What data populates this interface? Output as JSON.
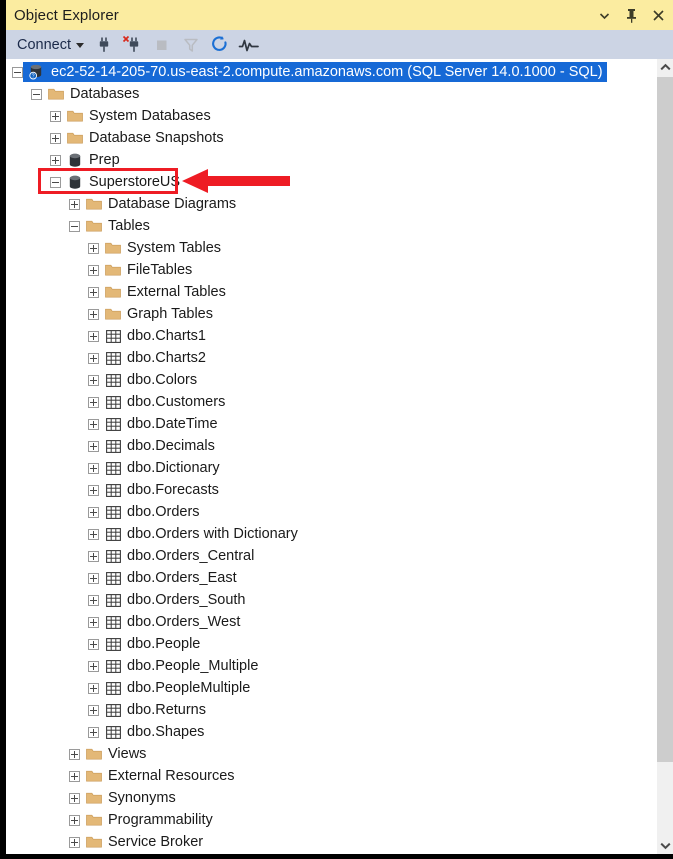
{
  "window": {
    "title": "Object Explorer",
    "controls": [
      {
        "name": "dropdown-icon",
        "label": "▾"
      },
      {
        "name": "pin-icon",
        "label": "Pin"
      },
      {
        "name": "close-icon",
        "label": "×"
      }
    ]
  },
  "toolbar": {
    "connect_label": "Connect",
    "icons": [
      {
        "name": "connect-icon",
        "title": "Connect",
        "enabled": true
      },
      {
        "name": "disconnect-icon",
        "title": "Disconnect",
        "enabled": true
      },
      {
        "name": "stop-icon",
        "title": "Stop",
        "enabled": false
      },
      {
        "name": "filter-icon",
        "title": "Filter",
        "enabled": false
      },
      {
        "name": "refresh-icon",
        "title": "Refresh",
        "enabled": true
      },
      {
        "name": "activity-monitor-icon",
        "title": "Activity Monitor",
        "enabled": true
      }
    ]
  },
  "colors": {
    "titlebar_bg": "#fbeca0",
    "toolbar_bg": "#ccd4e4",
    "selection_blue": "#1669d6",
    "folder_gold": "#e3b877",
    "annotation_red": "#ee1c24",
    "tree_bg": "#ffffff",
    "scrollbar_thumb": "#cdcdcd"
  },
  "tree": {
    "nodes": [
      {
        "label": "ec2-52-14-205-70.us-east-2.compute.amazonaws.com (SQL Server 14.0.1000 - SQL)",
        "indent": 0,
        "state": "expanded",
        "icon": "server-icon",
        "selected": true
      },
      {
        "label": "Databases",
        "indent": 1,
        "state": "expanded",
        "icon": "folder-icon",
        "selected": false
      },
      {
        "label": "System Databases",
        "indent": 2,
        "state": "collapsed",
        "icon": "folder-icon",
        "selected": false
      },
      {
        "label": "Database Snapshots",
        "indent": 2,
        "state": "collapsed",
        "icon": "folder-icon",
        "selected": false
      },
      {
        "label": "Prep",
        "indent": 2,
        "state": "collapsed",
        "icon": "database-icon",
        "selected": false
      },
      {
        "label": "SuperstoreUS",
        "indent": 2,
        "state": "expanded",
        "icon": "database-icon",
        "selected": false,
        "annotated": true
      },
      {
        "label": "Database Diagrams",
        "indent": 3,
        "state": "collapsed",
        "icon": "folder-icon",
        "selected": false
      },
      {
        "label": "Tables",
        "indent": 3,
        "state": "expanded",
        "icon": "folder-icon",
        "selected": false
      },
      {
        "label": "System Tables",
        "indent": 4,
        "state": "collapsed",
        "icon": "folder-icon",
        "selected": false
      },
      {
        "label": "FileTables",
        "indent": 4,
        "state": "collapsed",
        "icon": "folder-icon",
        "selected": false
      },
      {
        "label": "External Tables",
        "indent": 4,
        "state": "collapsed",
        "icon": "folder-icon",
        "selected": false
      },
      {
        "label": "Graph Tables",
        "indent": 4,
        "state": "collapsed",
        "icon": "folder-icon",
        "selected": false
      },
      {
        "label": "dbo.Charts1",
        "indent": 4,
        "state": "collapsed",
        "icon": "table-icon",
        "selected": false
      },
      {
        "label": "dbo.Charts2",
        "indent": 4,
        "state": "collapsed",
        "icon": "table-icon",
        "selected": false
      },
      {
        "label": "dbo.Colors",
        "indent": 4,
        "state": "collapsed",
        "icon": "table-icon",
        "selected": false
      },
      {
        "label": "dbo.Customers",
        "indent": 4,
        "state": "collapsed",
        "icon": "table-icon",
        "selected": false
      },
      {
        "label": "dbo.DateTime",
        "indent": 4,
        "state": "collapsed",
        "icon": "table-icon",
        "selected": false
      },
      {
        "label": "dbo.Decimals",
        "indent": 4,
        "state": "collapsed",
        "icon": "table-icon",
        "selected": false
      },
      {
        "label": "dbo.Dictionary",
        "indent": 4,
        "state": "collapsed",
        "icon": "table-icon",
        "selected": false
      },
      {
        "label": "dbo.Forecasts",
        "indent": 4,
        "state": "collapsed",
        "icon": "table-icon",
        "selected": false
      },
      {
        "label": "dbo.Orders",
        "indent": 4,
        "state": "collapsed",
        "icon": "table-icon",
        "selected": false
      },
      {
        "label": "dbo.Orders with Dictionary",
        "indent": 4,
        "state": "collapsed",
        "icon": "table-icon",
        "selected": false
      },
      {
        "label": "dbo.Orders_Central",
        "indent": 4,
        "state": "collapsed",
        "icon": "table-icon",
        "selected": false
      },
      {
        "label": "dbo.Orders_East",
        "indent": 4,
        "state": "collapsed",
        "icon": "table-icon",
        "selected": false
      },
      {
        "label": "dbo.Orders_South",
        "indent": 4,
        "state": "collapsed",
        "icon": "table-icon",
        "selected": false
      },
      {
        "label": "dbo.Orders_West",
        "indent": 4,
        "state": "collapsed",
        "icon": "table-icon",
        "selected": false
      },
      {
        "label": "dbo.People",
        "indent": 4,
        "state": "collapsed",
        "icon": "table-icon",
        "selected": false
      },
      {
        "label": "dbo.People_Multiple",
        "indent": 4,
        "state": "collapsed",
        "icon": "table-icon",
        "selected": false
      },
      {
        "label": "dbo.PeopleMultiple",
        "indent": 4,
        "state": "collapsed",
        "icon": "table-icon",
        "selected": false
      },
      {
        "label": "dbo.Returns",
        "indent": 4,
        "state": "collapsed",
        "icon": "table-icon",
        "selected": false
      },
      {
        "label": "dbo.Shapes",
        "indent": 4,
        "state": "collapsed",
        "icon": "table-icon",
        "selected": false
      },
      {
        "label": "Views",
        "indent": 3,
        "state": "collapsed",
        "icon": "folder-icon",
        "selected": false
      },
      {
        "label": "External Resources",
        "indent": 3,
        "state": "collapsed",
        "icon": "folder-icon",
        "selected": false
      },
      {
        "label": "Synonyms",
        "indent": 3,
        "state": "collapsed",
        "icon": "folder-icon",
        "selected": false
      },
      {
        "label": "Programmability",
        "indent": 3,
        "state": "collapsed",
        "icon": "folder-icon",
        "selected": false
      },
      {
        "label": "Service Broker",
        "indent": 3,
        "state": "collapsed",
        "icon": "folder-icon",
        "selected": false
      }
    ]
  },
  "annotation": {
    "highlighted_node": "SuperstoreUS",
    "arrow_direction": "left"
  }
}
